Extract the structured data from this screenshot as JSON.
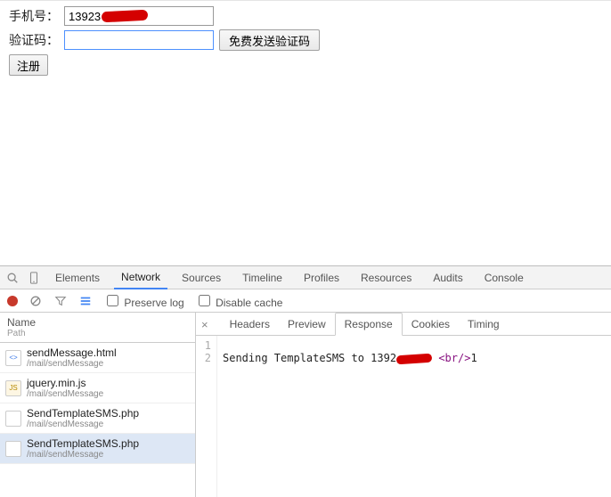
{
  "form": {
    "phone_label": "手机号：",
    "phone_value": "13923",
    "code_label": "验证码：",
    "code_value": "",
    "send_btn": "免费发送验证码",
    "register_btn": "注册"
  },
  "devtools": {
    "tabs": [
      "Elements",
      "Network",
      "Sources",
      "Timeline",
      "Profiles",
      "Resources",
      "Audits",
      "Console"
    ],
    "active_tab": "Network",
    "toolbar": {
      "preserve_log": "Preserve log",
      "disable_cache": "Disable cache"
    },
    "left": {
      "header_name": "Name",
      "header_path": "Path",
      "requests": [
        {
          "icon": "<>",
          "name": "sendMessage.html",
          "path": "/mail/sendMessage",
          "active": false
        },
        {
          "icon": "JS",
          "name": "jquery.min.js",
          "path": "/mail/sendMessage",
          "active": false
        },
        {
          "icon": "",
          "name": "SendTemplateSMS.php",
          "path": "/mail/sendMessage",
          "active": false
        },
        {
          "icon": "",
          "name": "SendTemplateSMS.php",
          "path": "/mail/sendMessage",
          "active": true
        }
      ]
    },
    "right": {
      "tabs": [
        "Headers",
        "Preview",
        "Response",
        "Cookies",
        "Timing"
      ],
      "active_tab": "Response",
      "lines": [
        "1",
        "2"
      ],
      "line2_prefix": "Sending TemplateSMS to 1392",
      "line2_tag": "<br/>",
      "line2_suffix": "1"
    }
  }
}
